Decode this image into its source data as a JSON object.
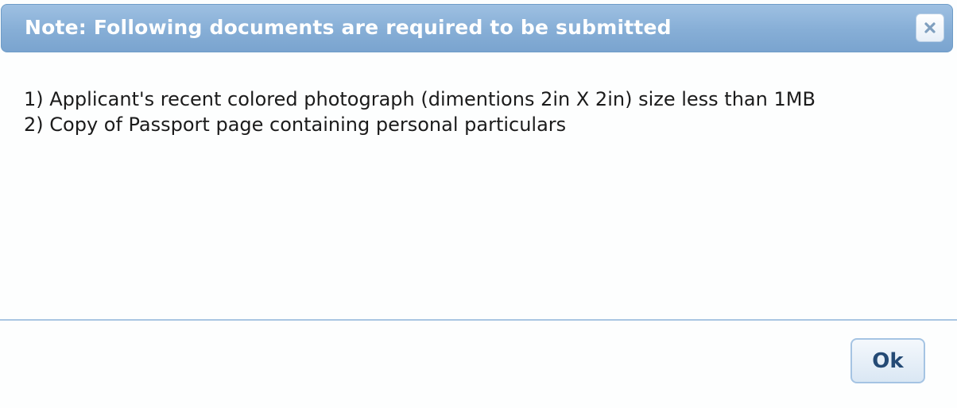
{
  "dialog": {
    "title": "Note: Following documents are required to be submitted",
    "close_icon": "close-icon",
    "items": [
      "1) Applicant's recent colored photograph (dimentions 2in X 2in) size less than 1MB",
      "2) Copy of Passport page containing personal particulars"
    ],
    "ok_label": "Ok"
  },
  "colors": {
    "titlebar": "#86aed6",
    "title_text": "#ffffff",
    "divider": "#a9c6e2",
    "ok_text": "#244a75"
  }
}
